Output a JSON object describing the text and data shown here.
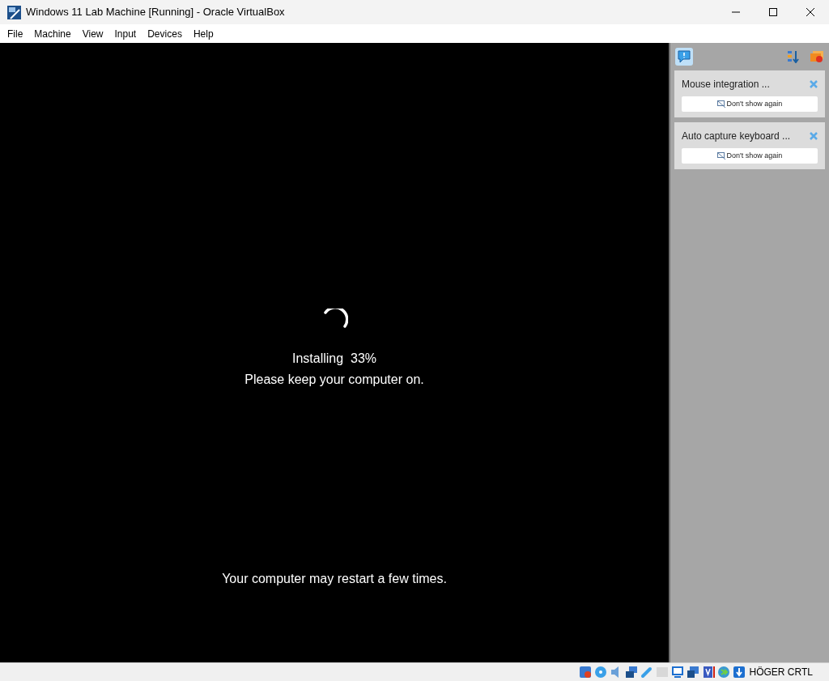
{
  "window": {
    "title": "Windows 11 Lab Machine [Running] - Oracle VirtualBox"
  },
  "menu": [
    "File",
    "Machine",
    "View",
    "Input",
    "Devices",
    "Help"
  ],
  "vm_screen": {
    "status": "Installing  33%",
    "message": "Please keep your computer on.",
    "note": "Your computer may restart a few times."
  },
  "notifications": [
    {
      "title": "Mouse integration ...",
      "button": "Don't show again"
    },
    {
      "title": "Auto capture keyboard ...",
      "button": "Don't show again"
    }
  ],
  "status_bar": {
    "host_key": "HÖGER CRTL"
  }
}
